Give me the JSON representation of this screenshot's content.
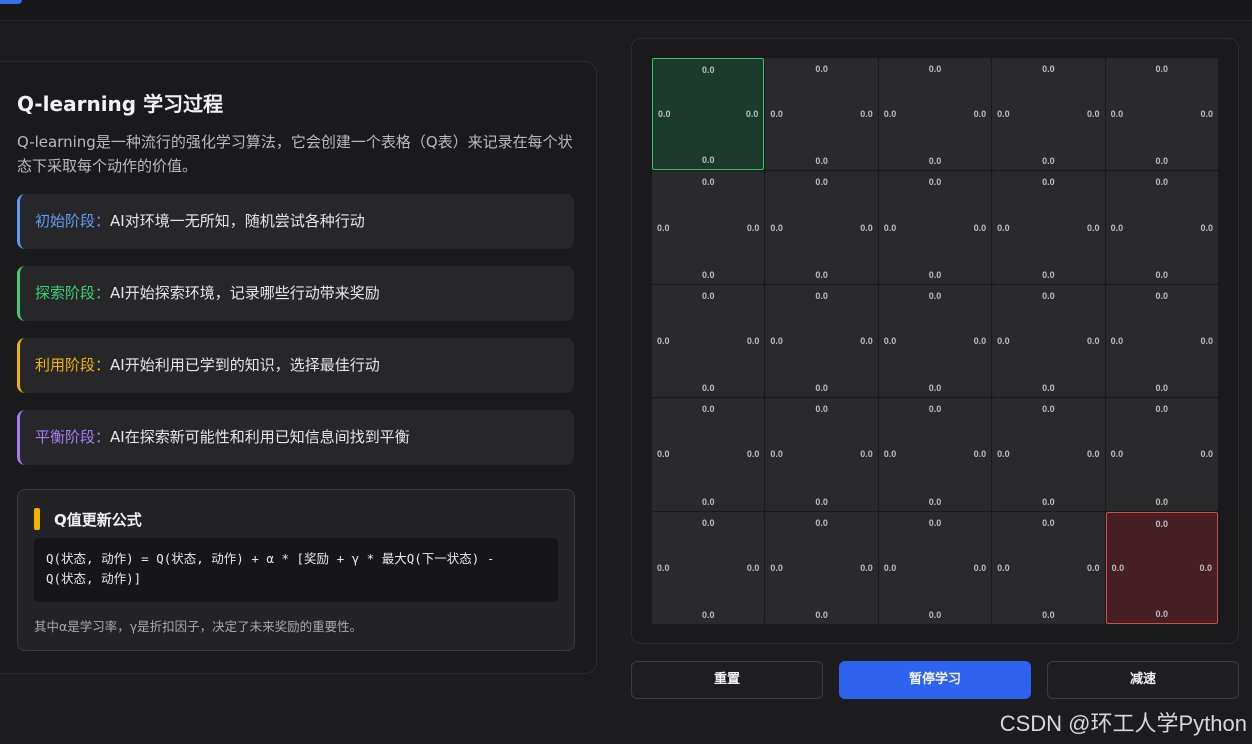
{
  "left_panel": {
    "title": "Q-learning 学习过程",
    "description": "Q-learning是一种流行的强化学习算法，它会创建一个表格（Q表）来记录在每个状态下采取每个动作的价值。",
    "stages": [
      {
        "name": "初始阶段：",
        "text": "AI对环境一无所知，随机尝试各种行动",
        "color": "#5b9cf5"
      },
      {
        "name": "探索阶段：",
        "text": "AI开始探索环境，记录哪些行动带来奖励",
        "color": "#3ecf74"
      },
      {
        "name": "利用阶段：",
        "text": "AI开始利用已学到的知识，选择最佳行动",
        "color": "#f0b400"
      },
      {
        "name": "平衡阶段：",
        "text": "AI在探索新可能性和利用已知信息间找到平衡",
        "color": "#a57cf5"
      }
    ],
    "formula": {
      "title": "Q值更新公式",
      "code_line1": "Q(状态, 动作) = Q(状态, 动作) + α * [奖励 + γ * 最大Q(下一状态) -",
      "code_line2": "Q(状态, 动作)]",
      "note": "其中α是学习率，γ是折扣因子，决定了未来奖励的重要性。"
    }
  },
  "grid": {
    "rows": 5,
    "cols": 5,
    "default_value": "0.0",
    "start_cell": [
      0,
      0
    ],
    "goal_cell": [
      4,
      4
    ]
  },
  "controls": {
    "reset": "重置",
    "pause": "暂停学习",
    "slow": "减速"
  },
  "watermark": "CSDN @环工人学Python"
}
